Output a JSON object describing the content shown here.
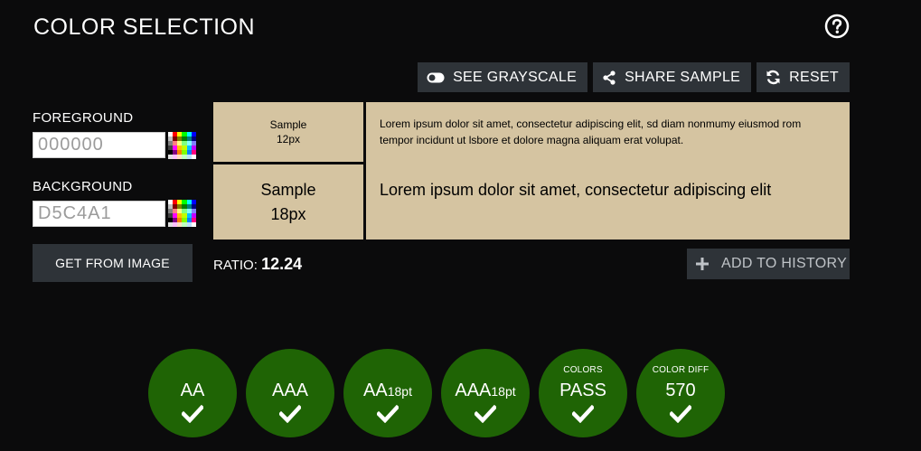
{
  "header": {
    "title": "COLOR SELECTION",
    "help_icon": "question-circle-icon"
  },
  "toolbar": {
    "grayscale_label": "SEE GRAYSCALE",
    "share_label": "SHARE SAMPLE",
    "reset_label": "RESET"
  },
  "foreground": {
    "label": "FOREGROUND",
    "value": "000000"
  },
  "background": {
    "label": "BACKGROUND",
    "value": "D5C4A1"
  },
  "get_from_image_label": "GET FROM IMAGE",
  "sample": {
    "small_title": "Sample",
    "small_size": "12px",
    "large_title": "Sample",
    "large_size": "18px",
    "small_text": "Lorem ipsum dolor sit amet, consectetur adipiscing elit, sd diam nonmumy eiusmod rom tempor incidunt ut lsbore et dolore magna aliquam erat volupat.",
    "large_text": "Lorem ipsum dolor sit amet, consectetur adipiscing elit",
    "background_color": "#d5c4a1",
    "foreground_color": "#000000"
  },
  "ratio": {
    "label": "RATIO:",
    "value": "12.24"
  },
  "add_history_label": "ADD TO HISTORY",
  "badges": [
    {
      "top": "",
      "main": "AA",
      "suffix": "",
      "status": "pass"
    },
    {
      "top": "",
      "main": "AAA",
      "suffix": "",
      "status": "pass"
    },
    {
      "top": "",
      "main": "AA",
      "suffix": "18pt",
      "status": "pass"
    },
    {
      "top": "",
      "main": "AAA",
      "suffix": "18pt",
      "status": "pass"
    },
    {
      "top": "COLORS",
      "main": "PASS",
      "suffix": "",
      "status": "pass"
    },
    {
      "top": "COLOR DIFF",
      "main": "570",
      "suffix": "",
      "status": "pass"
    }
  ],
  "colors": {
    "pass_green": "#1f6405",
    "button_bg": "#2e3338",
    "page_bg": "#0b0b0c"
  }
}
